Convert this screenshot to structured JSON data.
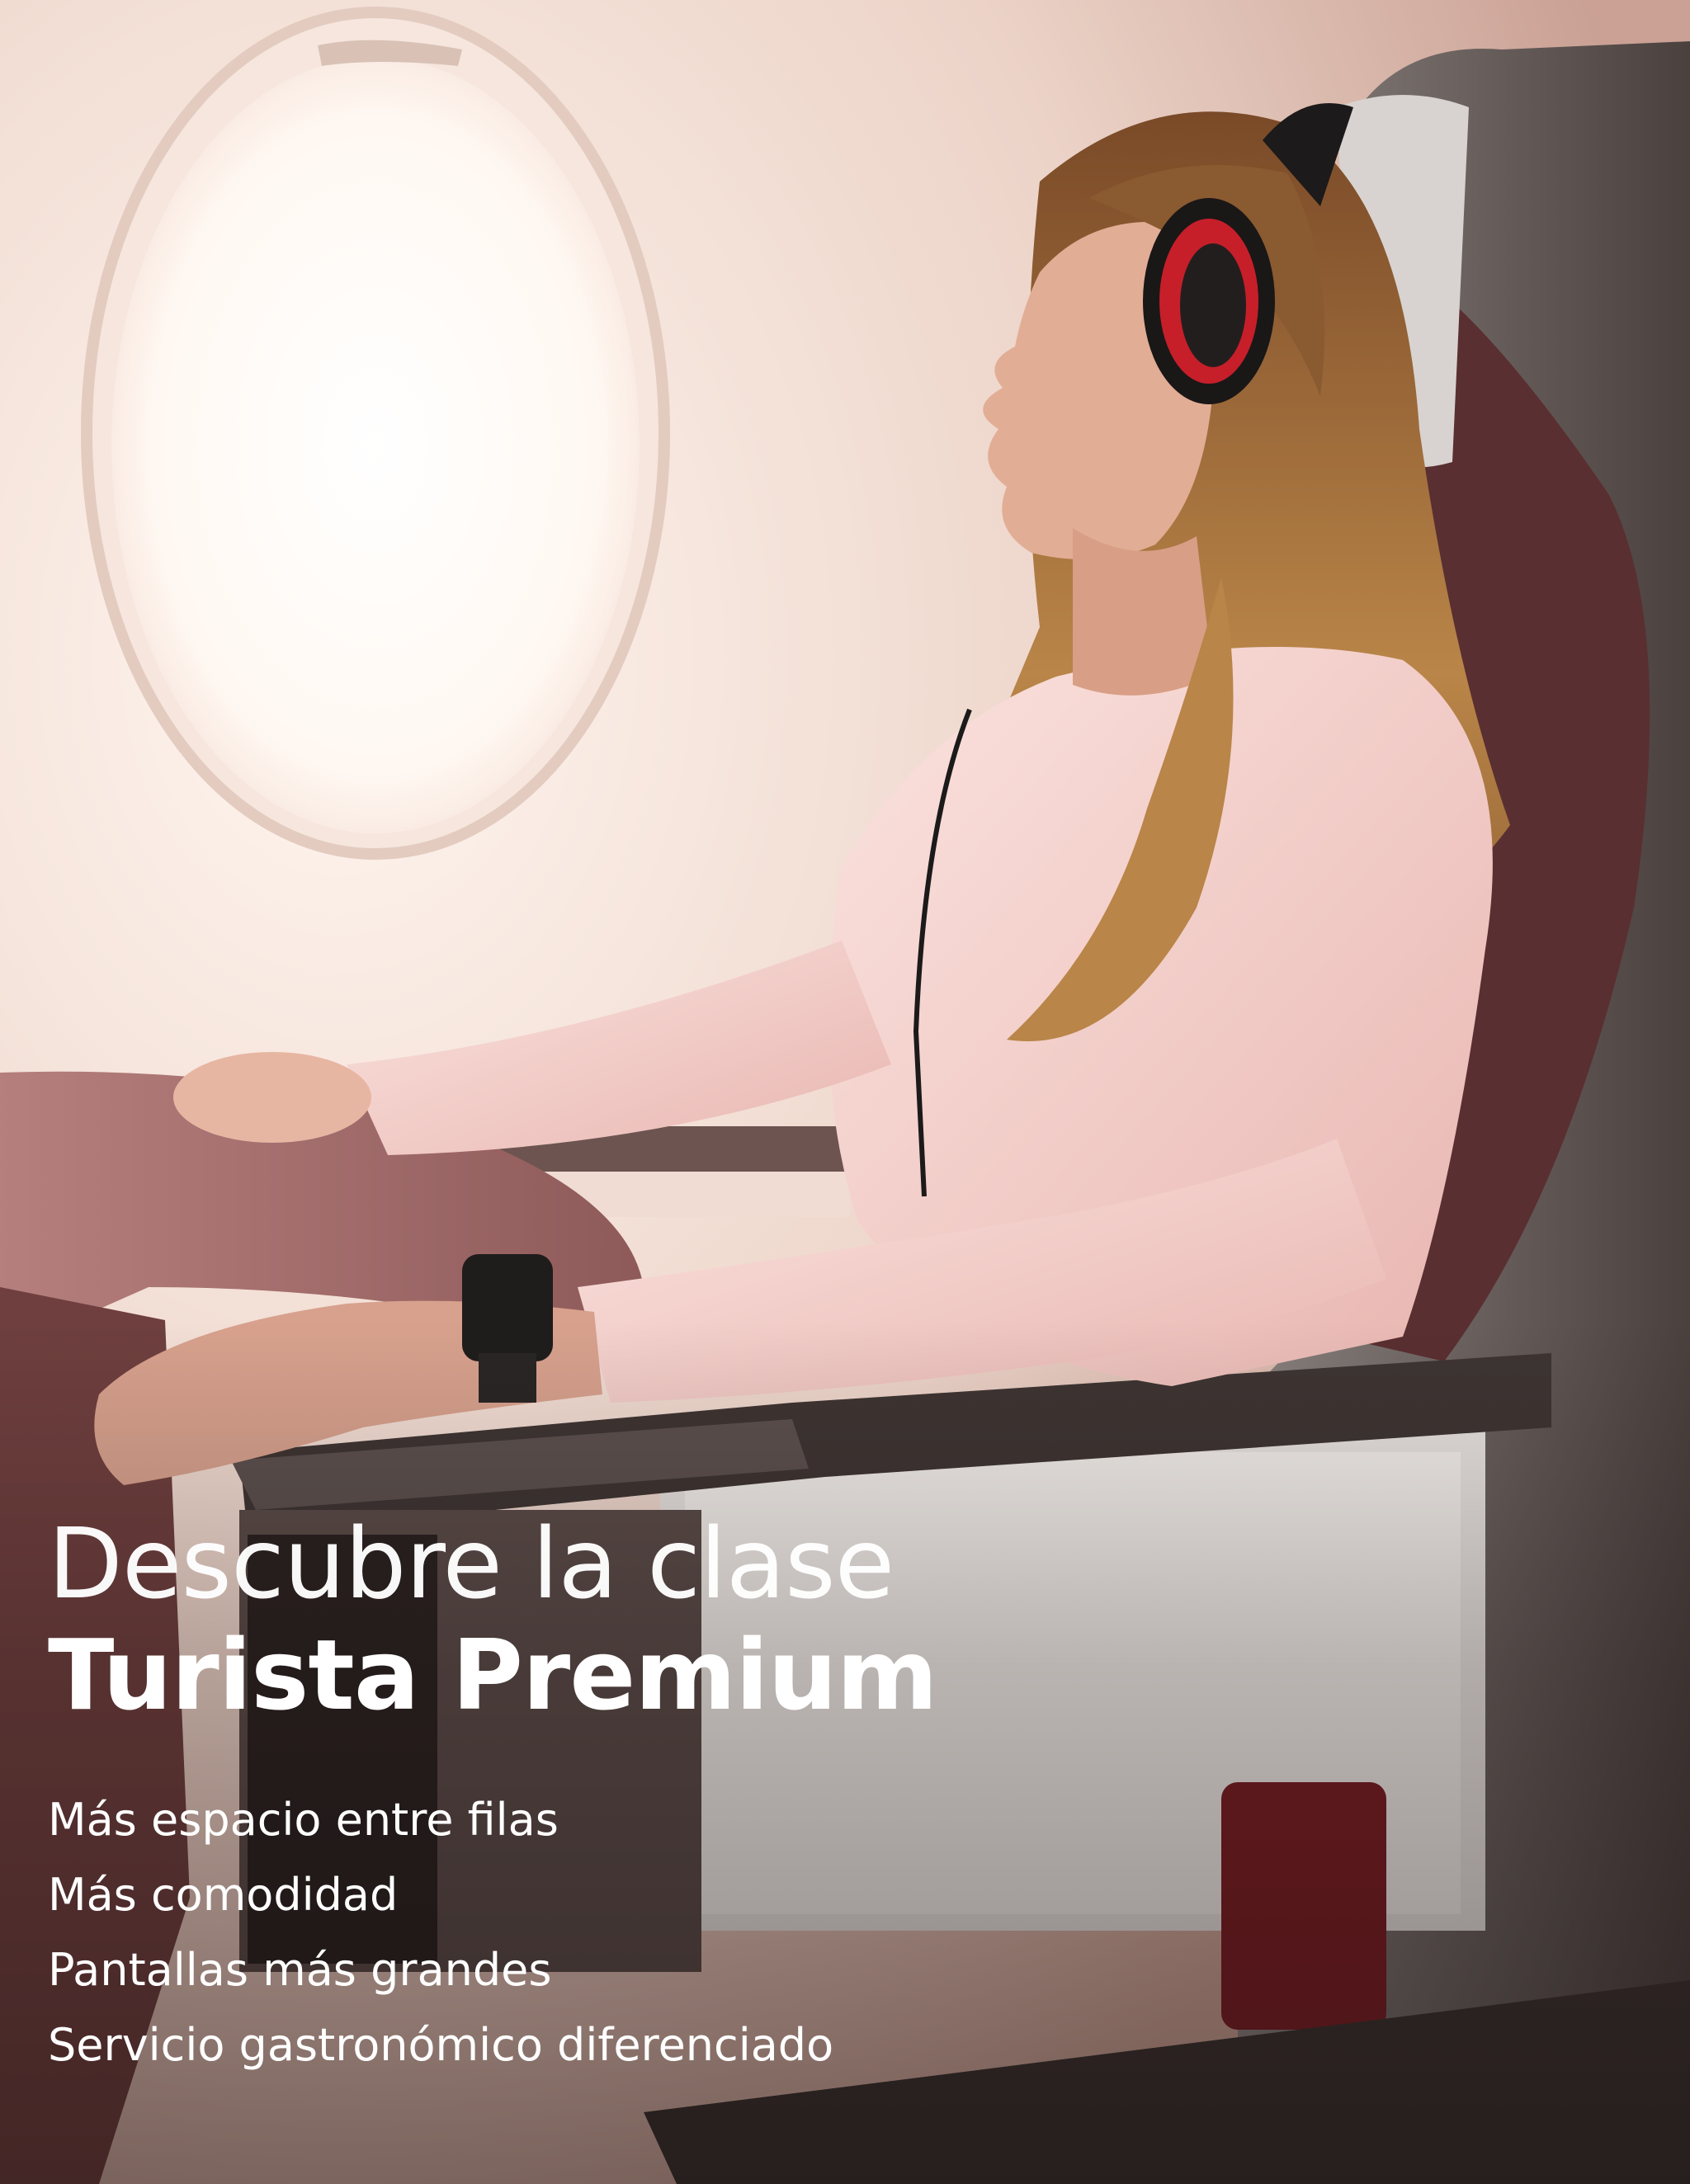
{
  "promo": {
    "headline_line1": "Descubre la clase",
    "headline_line2": "Turista Premium",
    "features": [
      "Más espacio entre filas",
      "Más comodidad",
      "Pantallas más grandes",
      "Servicio gastronómico diferenciado"
    ]
  },
  "colors": {
    "headline_text": "#ffffff",
    "cabin_wall": "#f1dfd6",
    "sweater": "#f2c8c3",
    "seat_shell": "#6d5f5c",
    "seat_fabric": "#5a2f31",
    "headphone_accent": "#c61f2a"
  },
  "photo": {
    "subject": "woman-with-headphones",
    "elements": [
      "airplane-window",
      "passenger",
      "headphones",
      "premium-seat",
      "armrest",
      "wristwatch"
    ]
  }
}
